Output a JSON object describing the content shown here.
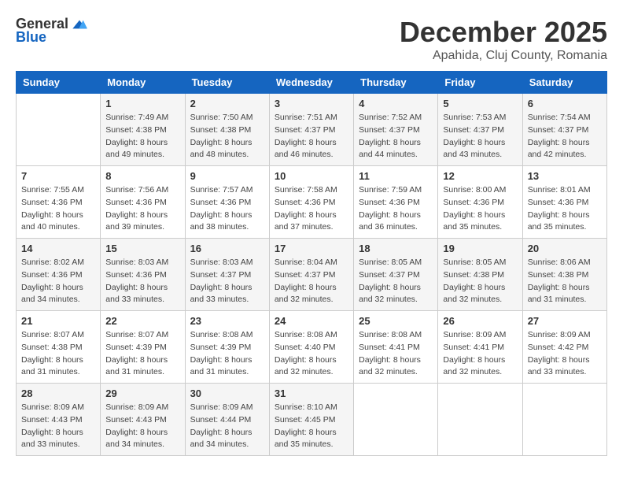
{
  "logo": {
    "general": "General",
    "blue": "Blue"
  },
  "title": "December 2025",
  "subtitle": "Apahida, Cluj County, Romania",
  "days_of_week": [
    "Sunday",
    "Monday",
    "Tuesday",
    "Wednesday",
    "Thursday",
    "Friday",
    "Saturday"
  ],
  "weeks": [
    [
      {
        "day": "",
        "info": ""
      },
      {
        "day": "1",
        "info": "Sunrise: 7:49 AM\nSunset: 4:38 PM\nDaylight: 8 hours and 49 minutes."
      },
      {
        "day": "2",
        "info": "Sunrise: 7:50 AM\nSunset: 4:38 PM\nDaylight: 8 hours and 48 minutes."
      },
      {
        "day": "3",
        "info": "Sunrise: 7:51 AM\nSunset: 4:37 PM\nDaylight: 8 hours and 46 minutes."
      },
      {
        "day": "4",
        "info": "Sunrise: 7:52 AM\nSunset: 4:37 PM\nDaylight: 8 hours and 44 minutes."
      },
      {
        "day": "5",
        "info": "Sunrise: 7:53 AM\nSunset: 4:37 PM\nDaylight: 8 hours and 43 minutes."
      },
      {
        "day": "6",
        "info": "Sunrise: 7:54 AM\nSunset: 4:37 PM\nDaylight: 8 hours and 42 minutes."
      }
    ],
    [
      {
        "day": "7",
        "info": "Sunrise: 7:55 AM\nSunset: 4:36 PM\nDaylight: 8 hours and 40 minutes."
      },
      {
        "day": "8",
        "info": "Sunrise: 7:56 AM\nSunset: 4:36 PM\nDaylight: 8 hours and 39 minutes."
      },
      {
        "day": "9",
        "info": "Sunrise: 7:57 AM\nSunset: 4:36 PM\nDaylight: 8 hours and 38 minutes."
      },
      {
        "day": "10",
        "info": "Sunrise: 7:58 AM\nSunset: 4:36 PM\nDaylight: 8 hours and 37 minutes."
      },
      {
        "day": "11",
        "info": "Sunrise: 7:59 AM\nSunset: 4:36 PM\nDaylight: 8 hours and 36 minutes."
      },
      {
        "day": "12",
        "info": "Sunrise: 8:00 AM\nSunset: 4:36 PM\nDaylight: 8 hours and 35 minutes."
      },
      {
        "day": "13",
        "info": "Sunrise: 8:01 AM\nSunset: 4:36 PM\nDaylight: 8 hours and 35 minutes."
      }
    ],
    [
      {
        "day": "14",
        "info": "Sunrise: 8:02 AM\nSunset: 4:36 PM\nDaylight: 8 hours and 34 minutes."
      },
      {
        "day": "15",
        "info": "Sunrise: 8:03 AM\nSunset: 4:36 PM\nDaylight: 8 hours and 33 minutes."
      },
      {
        "day": "16",
        "info": "Sunrise: 8:03 AM\nSunset: 4:37 PM\nDaylight: 8 hours and 33 minutes."
      },
      {
        "day": "17",
        "info": "Sunrise: 8:04 AM\nSunset: 4:37 PM\nDaylight: 8 hours and 32 minutes."
      },
      {
        "day": "18",
        "info": "Sunrise: 8:05 AM\nSunset: 4:37 PM\nDaylight: 8 hours and 32 minutes."
      },
      {
        "day": "19",
        "info": "Sunrise: 8:05 AM\nSunset: 4:38 PM\nDaylight: 8 hours and 32 minutes."
      },
      {
        "day": "20",
        "info": "Sunrise: 8:06 AM\nSunset: 4:38 PM\nDaylight: 8 hours and 31 minutes."
      }
    ],
    [
      {
        "day": "21",
        "info": "Sunrise: 8:07 AM\nSunset: 4:38 PM\nDaylight: 8 hours and 31 minutes."
      },
      {
        "day": "22",
        "info": "Sunrise: 8:07 AM\nSunset: 4:39 PM\nDaylight: 8 hours and 31 minutes."
      },
      {
        "day": "23",
        "info": "Sunrise: 8:08 AM\nSunset: 4:39 PM\nDaylight: 8 hours and 31 minutes."
      },
      {
        "day": "24",
        "info": "Sunrise: 8:08 AM\nSunset: 4:40 PM\nDaylight: 8 hours and 32 minutes."
      },
      {
        "day": "25",
        "info": "Sunrise: 8:08 AM\nSunset: 4:41 PM\nDaylight: 8 hours and 32 minutes."
      },
      {
        "day": "26",
        "info": "Sunrise: 8:09 AM\nSunset: 4:41 PM\nDaylight: 8 hours and 32 minutes."
      },
      {
        "day": "27",
        "info": "Sunrise: 8:09 AM\nSunset: 4:42 PM\nDaylight: 8 hours and 33 minutes."
      }
    ],
    [
      {
        "day": "28",
        "info": "Sunrise: 8:09 AM\nSunset: 4:43 PM\nDaylight: 8 hours and 33 minutes."
      },
      {
        "day": "29",
        "info": "Sunrise: 8:09 AM\nSunset: 4:43 PM\nDaylight: 8 hours and 34 minutes."
      },
      {
        "day": "30",
        "info": "Sunrise: 8:09 AM\nSunset: 4:44 PM\nDaylight: 8 hours and 34 minutes."
      },
      {
        "day": "31",
        "info": "Sunrise: 8:10 AM\nSunset: 4:45 PM\nDaylight: 8 hours and 35 minutes."
      },
      {
        "day": "",
        "info": ""
      },
      {
        "day": "",
        "info": ""
      },
      {
        "day": "",
        "info": ""
      }
    ]
  ]
}
